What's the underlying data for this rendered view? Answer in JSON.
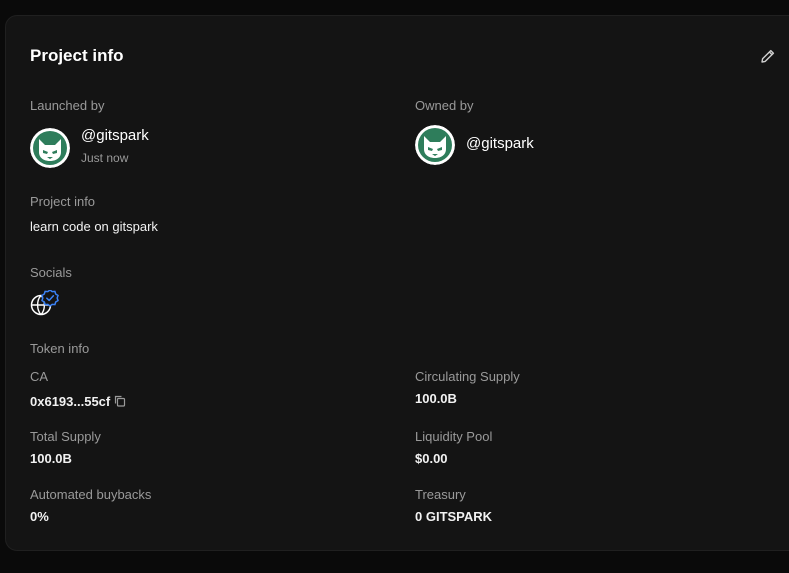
{
  "card": {
    "title": "Project info",
    "edit_icon": "pencil-icon"
  },
  "launched_by": {
    "label": "Launched by",
    "handle": "@gitspark",
    "time": "Just now",
    "avatar_icon": "cat-avatar"
  },
  "owned_by": {
    "label": "Owned by",
    "handle": "@gitspark",
    "avatar_icon": "cat-avatar"
  },
  "project_info": {
    "label": "Project info",
    "description": "learn code on gitspark"
  },
  "socials": {
    "label": "Socials",
    "icons": [
      "globe-icon",
      "verified-badge-icon"
    ]
  },
  "token_info": {
    "heading": "Token info",
    "ca": {
      "label": "CA",
      "value": "0x6193...55cf",
      "copy_icon": "copy-icon"
    },
    "circulating_supply": {
      "label": "Circulating Supply",
      "value": "100.0B"
    },
    "total_supply": {
      "label": "Total Supply",
      "value": "100.0B"
    },
    "liquidity_pool": {
      "label": "Liquidity Pool",
      "value": "$0.00"
    },
    "automated_buybacks": {
      "label": "Automated buybacks",
      "value": "0%"
    },
    "treasury": {
      "label": "Treasury",
      "value": "0 GITSPARK"
    }
  },
  "colors": {
    "background": "#0a0a0a",
    "card": "#141414",
    "avatar_green": "#2e7d5b",
    "verified_blue": "#3b82f6",
    "muted_text": "#9a9a9a"
  }
}
